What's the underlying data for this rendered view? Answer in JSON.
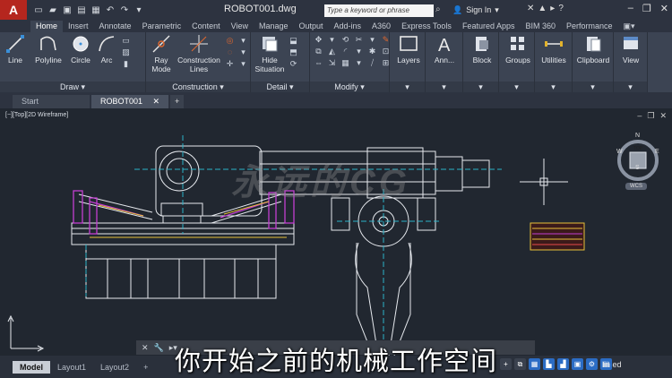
{
  "titlebar": {
    "logo": "A",
    "title": "ROBOT001.dwg",
    "search_placeholder": "Type a keyword or phrase",
    "signin": "Sign In"
  },
  "ribbon_tabs": [
    "Home",
    "Insert",
    "Annotate",
    "Parametric",
    "Content",
    "View",
    "Manage",
    "Output",
    "Add-ins",
    "A360",
    "Express Tools",
    "Featured Apps",
    "BIM 360",
    "Performance"
  ],
  "panels": {
    "draw": {
      "title": "Draw",
      "line": "Line",
      "polyline": "Polyline",
      "circle": "Circle",
      "arc": "Arc"
    },
    "construction": {
      "title": "Construction",
      "ray": "Ray",
      "mode": "Mode",
      "construction": "Construction",
      "lines": "Lines"
    },
    "detail": {
      "title": "Detail",
      "hide": "Hide",
      "situation": "Situation"
    },
    "modify": {
      "title": "Modify"
    },
    "layers": "Layers",
    "annotation": "Ann...",
    "block": "Block",
    "groups": "Groups",
    "utilities": "Utilities",
    "clipboard": "Clipboard",
    "view": "View"
  },
  "file_tabs": {
    "start": "Start",
    "active": "ROBOT001"
  },
  "viewport": {
    "label": "[−][Top][2D Wireframe]",
    "viewcube_top": "TOP",
    "compass": {
      "n": "N",
      "s": "S",
      "e": "E",
      "w": "W"
    },
    "wcs": "WCS",
    "watermark": "永远的CG"
  },
  "layout_tabs": {
    "model": "Model",
    "layout1": "Layout1",
    "layout2": "Layout2"
  },
  "subtitle": "你开始之前的机械工作空间",
  "brand": "lin ed",
  "colors": {
    "accent": "#b5261e",
    "ribbon": "#3c4453",
    "canvas": "#212730",
    "cyan": "#2bb3c8",
    "magenta": "#c23fd1"
  }
}
